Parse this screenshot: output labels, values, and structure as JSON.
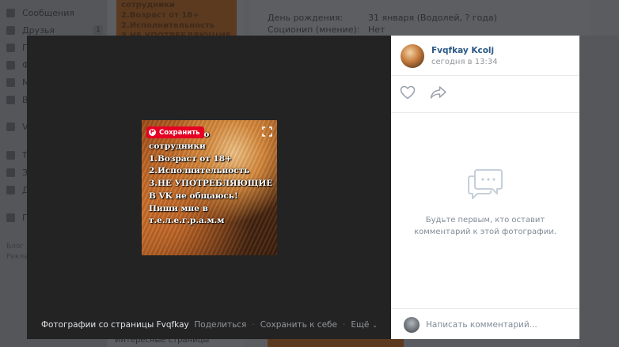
{
  "background": {
    "nav": [
      {
        "label": "Сообщения",
        "icon": "message-icon"
      },
      {
        "label": "Друзья",
        "icon": "friends-icon",
        "badge": "1"
      },
      {
        "label": "Г",
        "icon": "groups-icon"
      },
      {
        "label": "Ф",
        "icon": "photos-icon"
      },
      {
        "label": "М",
        "icon": "music-icon"
      },
      {
        "label": "В",
        "icon": "games-icon"
      },
      {
        "label": "V",
        "icon": "pay-icon"
      },
      {
        "label": "Т",
        "icon": "store-icon"
      },
      {
        "label": "З",
        "icon": "bookmark-icon"
      },
      {
        "label": "Д",
        "icon": "document-icon"
      },
      {
        "label": "Г",
        "icon": "group-icon"
      }
    ],
    "footer_links": [
      "Блог",
      "Рекла"
    ],
    "post_thumb_lines": [
      "сотрудники",
      "2.Возраст от 18+",
      "2.Исполнительность",
      "3.НЕ УПОТРЕБЛЯЮЩИЕ"
    ],
    "profile_rows": [
      {
        "label": "День рождения:",
        "value": "31 января (Водолей, ? года)"
      },
      {
        "label": "Соционип (мнение):",
        "value": "Нет"
      }
    ],
    "bottom_link": "Интересные страницы"
  },
  "viewer": {
    "photo": {
      "lines": [
        "чно",
        "сотрудники",
        "1.Возраст от 18+",
        "2.Исполнительность",
        "3.НЕ УПОТРЕБЛЯЮЩИЕ",
        "В VK не общаюсь!",
        "Пиши мне в",
        "т.е.л.е.г.р.а.м.м"
      ],
      "pin_label": "Сохранить",
      "colors": {
        "pin": "#e60023"
      }
    },
    "footer": {
      "title": "Фотографии со страницы Fvqfkay",
      "actions": {
        "share": "Поделиться",
        "save": "Сохранить к себе",
        "more": "Ещё"
      }
    },
    "panel": {
      "author": "Fvqfkay Kcolj",
      "date": "сегодня в 13:34",
      "empty_comments": [
        "Будьте первым, кто оставит",
        "комментарий к этой фотографии."
      ],
      "comment_placeholder": "Написать комментарий...",
      "colors": {
        "link": "#2a5885",
        "muted": "#818c99"
      }
    }
  }
}
